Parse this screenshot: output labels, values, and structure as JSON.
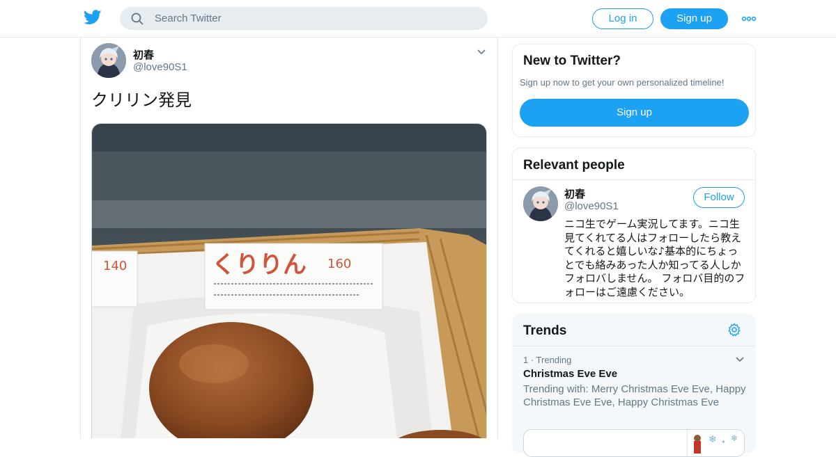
{
  "header": {
    "search_placeholder": "Search Twitter",
    "login_label": "Log in",
    "signup_label": "Sign up"
  },
  "tweet": {
    "display_name": "初春",
    "handle": "@love90S1",
    "text": "クリリン発見",
    "photo": {
      "sign_price_left": "140",
      "sign_title": "くりりん",
      "sign_price": "160"
    }
  },
  "signup_card": {
    "title": "New to Twitter?",
    "subtitle": "Sign up now to get your own personalized timeline!",
    "button_label": "Sign up"
  },
  "relevant_people": {
    "title": "Relevant people",
    "person": {
      "display_name": "初春",
      "handle": "@love90S1",
      "follow_label": "Follow",
      "bio": "ニコ生でゲーム実況してます。ニコ生見てくれてる人はフォローしたら教えてくれると嬉しいな♪基本的にちょっとでも絡みあった人か知ってる人しかフォロバしません。 フォロバ目的のフォローはご遠慮ください。"
    }
  },
  "trends": {
    "title": "Trends",
    "items": [
      {
        "meta": "1 · Trending",
        "name": "Christmas Eve Eve",
        "trending_with": "Trending with: Merry Christmas Eve Eve, Happy Christmas Eve Eve, Happy Christmas Eve"
      }
    ]
  },
  "colors": {
    "brand": "#1da1f2",
    "text_primary": "#14171a",
    "text_secondary": "#657786",
    "border": "#e6ecf0"
  }
}
